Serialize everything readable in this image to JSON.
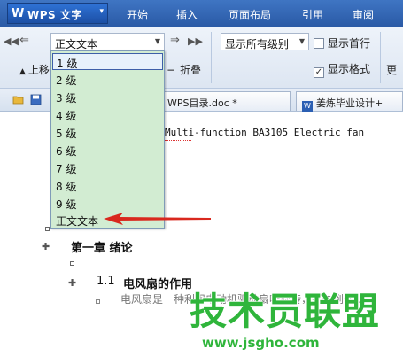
{
  "app": {
    "logo": "W",
    "name": "WPS 文字",
    "dropdown_glyph": "▾"
  },
  "menu": [
    "开始",
    "插入",
    "页面布局",
    "引用",
    "审阅"
  ],
  "ribbon": {
    "style_combo_value": "正文文本",
    "level_combo_value": "显示所有级别",
    "show_first_line": "显示首行",
    "show_format": "显示格式",
    "move_up": "上移",
    "collapse": "折叠",
    "truncated_label": "更"
  },
  "tabs": {
    "tab1": "WPS目录.doc *",
    "tab2": "姜炼毕业设计+"
  },
  "dropdown": {
    "items": [
      "1 级",
      "2 级",
      "3 级",
      "4 级",
      "5 级",
      "6 级",
      "7 级",
      "8 级",
      "9 级",
      "正文文本"
    ],
    "highlighted_index": 0
  },
  "document": {
    "line1": "Multi-function  BA3105  Electric fan",
    "chapter_heading": "第一章  绪论",
    "section_number": "1.1",
    "section_title": "电风扇的作用",
    "body_partial": "电风扇是一种利用电动机驱动扇叶旋转，来达到使..."
  },
  "watermark": {
    "text": "技术员联盟",
    "url": "www.jsgho.com"
  },
  "colors": {
    "accent": "#2a5aa6",
    "dropdown_bg": "#d2ecd2",
    "arrow_red": "#d9281e",
    "watermark_green": "#2fb53b"
  }
}
